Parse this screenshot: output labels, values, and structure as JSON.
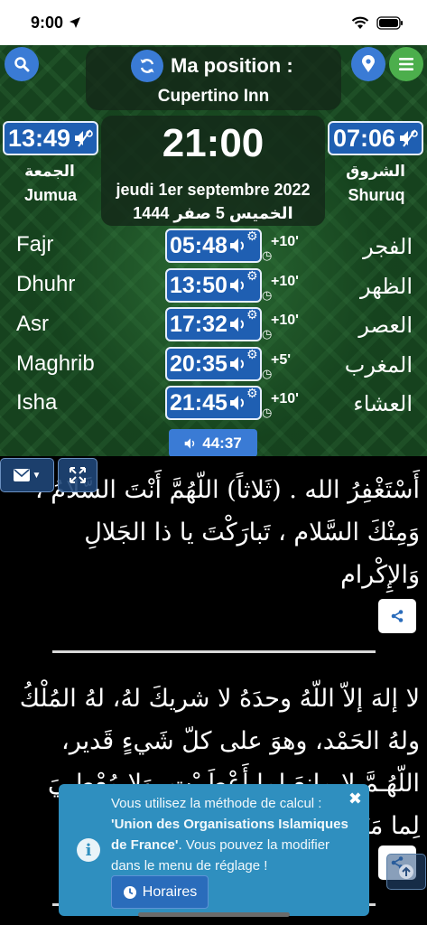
{
  "status_bar": {
    "time": "9:00"
  },
  "header": {
    "title": "Ma position :",
    "location": "Cupertino Inn"
  },
  "jumua": {
    "time": "13:49",
    "label_ar": "الجمعة",
    "label": "Jumua"
  },
  "shuruq": {
    "time": "07:06",
    "label_ar": "الشروق",
    "label": "Shuruq"
  },
  "clock": {
    "time": "21:00",
    "date": "jeudi 1er septembre 2022",
    "hijri": "الخميس 5 صفر 1444"
  },
  "prayers": [
    {
      "name": "Fajr",
      "name_ar": "الفجر",
      "time": "05:48",
      "offset": "+10'"
    },
    {
      "name": "Dhuhr",
      "name_ar": "الظهر",
      "time": "13:50",
      "offset": "+10'"
    },
    {
      "name": "Asr",
      "name_ar": "العصر",
      "time": "17:32",
      "offset": "+10'"
    },
    {
      "name": "Maghrib",
      "name_ar": "المغرب",
      "time": "20:35",
      "offset": "+5'"
    },
    {
      "name": "Isha",
      "name_ar": "العشاء",
      "time": "21:45",
      "offset": "+10'"
    }
  ],
  "countdown": "44:37",
  "dhikr": [
    "أَسْتَغْفِرُ الله . (ثَلاثاً) اللّهُمَّ أَنْتَ السَّلامُ ، وَمِنْكَ السَّلام ، تَبارَكْتَ يا ذا الجَلالِ وَالإِكْرام",
    "لا إلهَ إلاّ اللّهُ وحدَهُ لا شريكَ لهُ، لهُ المُلْكُ ولهُ الحَمْد، وهوَ على كلّ شَيءٍ قَدير، اللّهُـمَّ لا مانِعَ لِما أَعْطَـيْت، وَلا مُعْطِـيَ لِما مَنَعْـت"
  ],
  "toast": {
    "line1": "Vous utilisez la méthode de calcul :",
    "method": "'Union des Organisations Islamiques de France'",
    "line2": ". Vous pouvez la modifier dans le menu de réglage !",
    "button": "Horaires",
    "close": "✖"
  },
  "colors": {
    "accent_blue": "#3a7bd5",
    "badge_blue": "#1f5fb2",
    "menu_green": "#4cae4c",
    "toast_blue": "#2f8fbf"
  }
}
